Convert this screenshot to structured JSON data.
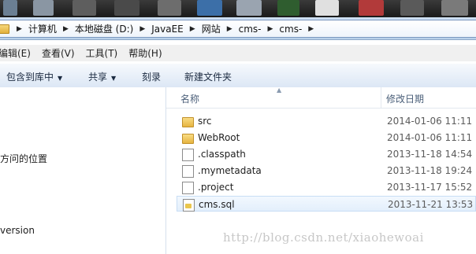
{
  "breadcrumb": [
    "计算机",
    "本地磁盘 (D:)",
    "JavaEE",
    "网站",
    "cms-",
    "cms-"
  ],
  "menu": [
    "编辑(E)",
    "查看(V)",
    "工具(T)",
    "帮助(H)"
  ],
  "toolbar": {
    "include_library": "包含到库中",
    "share": "共享",
    "burn": "刻录",
    "new_folder": "新建文件夹"
  },
  "nav": {
    "recent_places": "方问的位置",
    "version": "version"
  },
  "columns": {
    "name": "名称",
    "date": "修改日期"
  },
  "files": [
    {
      "name": "src",
      "date": "2014-01-06 11:11",
      "icon": "folder-icon"
    },
    {
      "name": "WebRoot",
      "date": "2014-01-06 11:11",
      "icon": "folder-icon"
    },
    {
      "name": ".classpath",
      "date": "2013-11-18 14:54",
      "icon": "file-icon"
    },
    {
      "name": ".mymetadata",
      "date": "2013-11-18 19:24",
      "icon": "file-icon"
    },
    {
      "name": ".project",
      "date": "2013-11-17 15:52",
      "icon": "file-icon"
    },
    {
      "name": "cms.sql",
      "date": "2013-11-21 13:53",
      "icon": "sql-file-icon",
      "selected": true
    }
  ],
  "watermark": "http://blog.csdn.net/xiaohewoai"
}
